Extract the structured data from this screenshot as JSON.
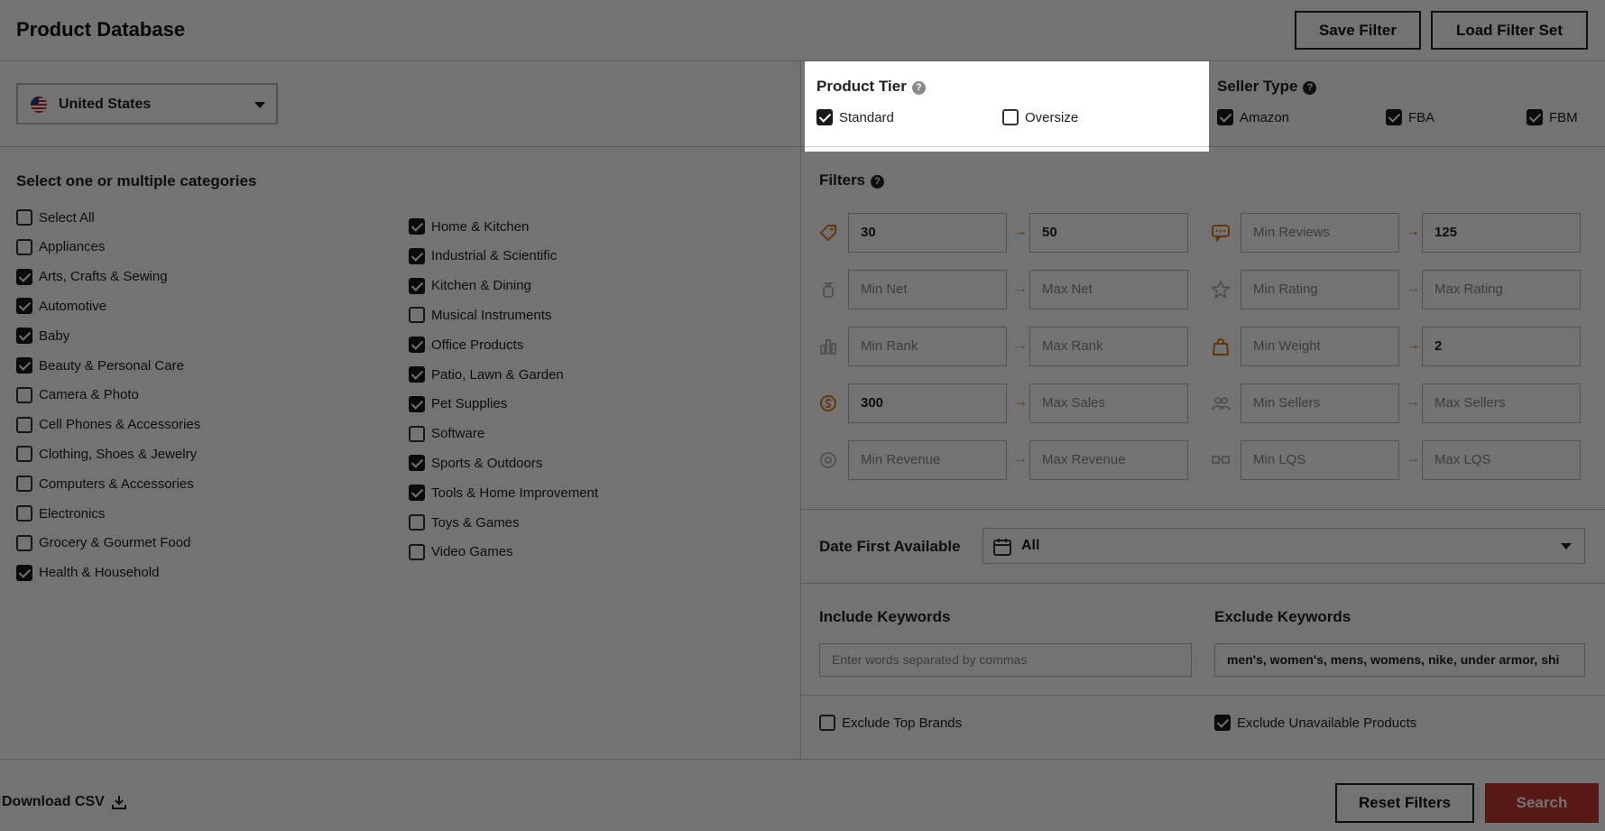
{
  "header": {
    "title": "Product Database",
    "save_filter": "Save Filter",
    "load_filter_set": "Load Filter Set"
  },
  "country": {
    "selected": "United States",
    "icon": "us-flag-icon"
  },
  "categories": {
    "title": "Select one or multiple categories",
    "col1": [
      {
        "label": "Select All",
        "checked": false
      },
      {
        "label": "Appliances",
        "checked": false
      },
      {
        "label": "Arts, Crafts & Sewing",
        "checked": true
      },
      {
        "label": "Automotive",
        "checked": true
      },
      {
        "label": "Baby",
        "checked": true
      },
      {
        "label": "Beauty & Personal Care",
        "checked": true
      },
      {
        "label": "Camera & Photo",
        "checked": false
      },
      {
        "label": "Cell Phones & Accessories",
        "checked": false
      },
      {
        "label": "Clothing, Shoes & Jewelry",
        "checked": false
      },
      {
        "label": "Computers & Accessories",
        "checked": false
      },
      {
        "label": "Electronics",
        "checked": false
      },
      {
        "label": "Grocery & Gourmet Food",
        "checked": false
      },
      {
        "label": "Health & Household",
        "checked": true
      }
    ],
    "col2": [
      {
        "label": "Home & Kitchen",
        "checked": true
      },
      {
        "label": "Industrial & Scientific",
        "checked": true
      },
      {
        "label": "Kitchen & Dining",
        "checked": true
      },
      {
        "label": "Musical Instruments",
        "checked": false
      },
      {
        "label": "Office Products",
        "checked": true
      },
      {
        "label": "Patio, Lawn & Garden",
        "checked": true
      },
      {
        "label": "Pet Supplies",
        "checked": true
      },
      {
        "label": "Software",
        "checked": false
      },
      {
        "label": "Sports & Outdoors",
        "checked": true
      },
      {
        "label": "Tools & Home Improvement",
        "checked": true
      },
      {
        "label": "Toys & Games",
        "checked": false
      },
      {
        "label": "Video Games",
        "checked": false
      }
    ]
  },
  "product_tier": {
    "title": "Product Tier",
    "options": [
      {
        "label": "Standard",
        "checked": true
      },
      {
        "label": "Oversize",
        "checked": false
      }
    ]
  },
  "seller_type": {
    "title": "Seller Type",
    "options": [
      {
        "label": "Amazon",
        "checked": true
      },
      {
        "label": "FBA",
        "checked": true
      },
      {
        "label": "FBM",
        "checked": true
      }
    ]
  },
  "filters": {
    "title": "Filters",
    "rows": [
      {
        "icon": "price-tag-icon",
        "min": "30",
        "max": "50",
        "min_filled": true,
        "max_filled": true
      },
      {
        "icon": "money-bag-icon",
        "min": "Min Net",
        "max": "Max Net",
        "min_filled": false,
        "max_filled": false
      },
      {
        "icon": "bar-chart-icon",
        "min": "Min Rank",
        "max": "Max Rank",
        "min_filled": false,
        "max_filled": false
      },
      {
        "icon": "dollar-icon",
        "min": "300",
        "max": "Max Sales",
        "min_filled": true,
        "max_filled": false
      },
      {
        "icon": "revenue-icon",
        "min": "Min Revenue",
        "max": "Max Revenue",
        "min_filled": false,
        "max_filled": false
      }
    ],
    "rows_right": [
      {
        "icon": "reviews-icon",
        "min": "Min Reviews",
        "max": "125",
        "min_filled": false,
        "max_filled": true
      },
      {
        "icon": "star-icon",
        "min": "Min Rating",
        "max": "Max Rating",
        "min_filled": false,
        "max_filled": false
      },
      {
        "icon": "weight-bag-icon",
        "min": "Min Weight",
        "max": "2",
        "min_filled": false,
        "max_filled": true
      },
      {
        "icon": "sellers-icon",
        "min": "Min Sellers",
        "max": "Max Sellers",
        "min_filled": false,
        "max_filled": false
      },
      {
        "icon": "lqs-icon",
        "min": "Min LQS",
        "max": "Max LQS",
        "min_filled": false,
        "max_filled": false
      }
    ]
  },
  "date_first_available": {
    "label": "Date First Available",
    "value": "All"
  },
  "include_keywords": {
    "label": "Include Keywords",
    "placeholder": "Enter words separated by commas",
    "value": ""
  },
  "exclude_keywords": {
    "label": "Exclude Keywords",
    "value": "men's, women's, mens, womens, nike, under armor, shi"
  },
  "exclude_top_brands": {
    "label": "Exclude Top Brands",
    "checked": false
  },
  "exclude_unavailable": {
    "label": "Exclude Unavailable Products",
    "checked": true
  },
  "footer": {
    "download_csv": "Download CSV",
    "reset_filters": "Reset Filters",
    "search": "Search"
  },
  "colors": {
    "accent": "#e07b13",
    "search": "#c0392b"
  }
}
